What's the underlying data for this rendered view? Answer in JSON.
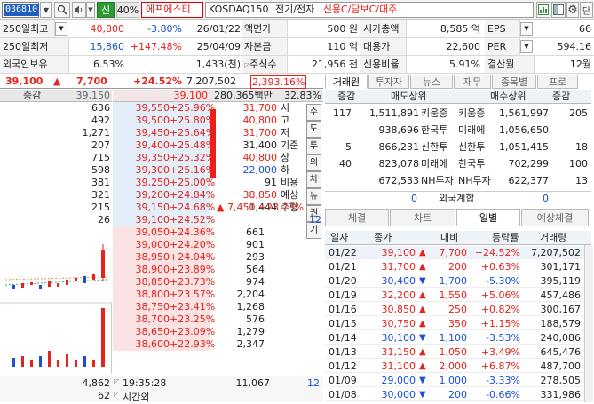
{
  "toolbar": {
    "code": "036810",
    "lang": "신",
    "zoom": "40%",
    "stock_name": "에프에스티",
    "index": "KOSDAQ150",
    "sector": "전기/전자",
    "tags": "신용C/담보C/대주",
    "letter": "단"
  },
  "summary": {
    "row1": {
      "label": "250일최고",
      "value": "40,800",
      "rate": "-3.80%",
      "date": "26/01/22",
      "l2": "액면가",
      "v2": "500 원",
      "l3": "시가총액",
      "v3": "8,585 억",
      "l4": "EPS",
      "v4": "66"
    },
    "row2": {
      "label": "250일최저",
      "value": "15,860",
      "rate": "+147.48%",
      "date": "25/04/09",
      "l2": "자본금",
      "v2": "110 억",
      "l3": "대용가",
      "v3": "22,600",
      "l4": "PER",
      "v4": "594.16"
    },
    "row3": {
      "label": "외국인보유",
      "value": "6.53%",
      "rate": "1,433(천)",
      "l2": "주식수",
      "v2": "21,956 천",
      "l3": "신용비율",
      "v3": "5.91%",
      "l4": "결산월",
      "v4": "12월"
    }
  },
  "price": {
    "current": "39,100",
    "arrow": "▲",
    "change": "7,700",
    "rate": "+24.52%",
    "volume": "7,207,502",
    "ratio": "2,393.16%"
  },
  "ob_header": {
    "label": "증감",
    "p1": "39,150",
    "p2": "39,100",
    "amount": "280,365백만",
    "rate": "32.83%"
  },
  "asks": [
    {
      "q": "636",
      "p": "39,550",
      "r": "+25.96%"
    },
    {
      "q": "492",
      "p": "39,500",
      "r": "+25.80%"
    },
    {
      "q": "1,271",
      "p": "39,450",
      "r": "+25.64%"
    },
    {
      "q": "207",
      "p": "39,400",
      "r": "+25.48%"
    },
    {
      "q": "715",
      "p": "39,350",
      "r": "+25.32%"
    },
    {
      "q": "598",
      "p": "39,300",
      "r": "+25.16%"
    },
    {
      "q": "381",
      "p": "39,250",
      "r": "+25.00%"
    },
    {
      "q": "321",
      "p": "39,200",
      "r": "+24.84%"
    },
    {
      "q": "215",
      "p": "39,150",
      "r": "+24.68%"
    },
    {
      "q": "26",
      "p": "39,100",
      "r": "+24.52%"
    }
  ],
  "side_info": [
    {
      "v": "31,700",
      "l": "시"
    },
    {
      "v": "40,800",
      "l": "고"
    },
    {
      "v": "31,700",
      "l": "저"
    },
    {
      "v": "31,400",
      "l": "기준"
    },
    {
      "v": "40,800",
      "l": "상"
    },
    {
      "v": "22,000",
      "l": "하"
    },
    {
      "v": "91",
      "l": "비용"
    },
    {
      "v": "38,850",
      "l": "예상"
    },
    {
      "v": "1,444",
      "l": "수량"
    }
  ],
  "expected": {
    "arrow": "▲",
    "change": "7,450",
    "rate": "+23.73%"
  },
  "side_tabs": [
    "수",
    "도",
    "투",
    "외",
    "차",
    "뉴",
    "권",
    "기"
  ],
  "bids": [
    {
      "p": "39,050",
      "r": "+24.36%",
      "q": "661"
    },
    {
      "p": "39,000",
      "r": "+24.20%",
      "q": "901"
    },
    {
      "p": "38,950",
      "r": "+24.04%",
      "q": "293"
    },
    {
      "p": "38,900",
      "r": "+23.89%",
      "q": "564"
    },
    {
      "p": "38,850",
      "r": "+23.73%",
      "q": "974"
    },
    {
      "p": "38,800",
      "r": "+23.57%",
      "q": "2,204"
    },
    {
      "p": "38,750",
      "r": "+23.41%",
      "q": "1,268"
    },
    {
      "p": "38,700",
      "r": "+23.25%",
      "q": "576"
    },
    {
      "p": "38,650",
      "r": "+23.09%",
      "q": "1,279"
    },
    {
      "p": "38,600",
      "r": "+22.93%",
      "q": "2,347"
    }
  ],
  "bid_side_val": "12",
  "ob_footer": {
    "total_ask": "4,862",
    "time": "19:35:28",
    "total_bid": "11,067",
    "right": "12",
    "count": "62",
    "time_label": "시간외"
  },
  "right_tabs": [
    "거래원",
    "투자자",
    "뉴스",
    "재무",
    "종목별",
    "프로"
  ],
  "broker": {
    "h_change1": "증감",
    "h_sell": "매도상위",
    "h_buy": "매수상위",
    "h_change2": "증감",
    "rows": [
      {
        "c1": "117",
        "sv": "1,511,891",
        "sn": "키움증",
        "bn": "키움증",
        "bv": "1,561,997",
        "c2": "205"
      },
      {
        "c1": "",
        "sv": "938,696",
        "sn": "한국투",
        "bn": "미래에",
        "bv": "1,056,650",
        "c2": ""
      },
      {
        "c1": "5",
        "sv": "866,231",
        "sn": "신한투",
        "bn": "신한투",
        "bv": "1,051,415",
        "c2": "18"
      },
      {
        "c1": "40",
        "sv": "823,078",
        "sn": "미래에",
        "bn": "한국투",
        "bv": "702,299",
        "c2": "100"
      },
      {
        "c1": "",
        "sv": "672,533",
        "sn": "NH투자",
        "bn": "NH투자",
        "bv": "622,377",
        "c2": "13"
      }
    ],
    "foreign": {
      "left": "0",
      "label": "외국계합",
      "right": "0"
    }
  },
  "sub_tabs": [
    "체결",
    "차트",
    "일별",
    "예상체결"
  ],
  "daily": {
    "headers": [
      "일자",
      "종가",
      "대비",
      "등락률",
      "거래량"
    ],
    "rows": [
      {
        "d": "01/22",
        "c": "39,100",
        "a": "▲",
        "v": "7,700",
        "r": "+24.52%",
        "vol": "7,207,502",
        "dir": "up"
      },
      {
        "d": "01/21",
        "c": "31,700",
        "a": "▲",
        "v": "200",
        "r": "+0.63%",
        "vol": "301,171",
        "dir": "up"
      },
      {
        "d": "01/20",
        "c": "30,400",
        "a": "▼",
        "v": "1,700",
        "r": "-5.30%",
        "vol": "395,119",
        "dir": "down"
      },
      {
        "d": "01/19",
        "c": "32,200",
        "a": "▲",
        "v": "1,550",
        "r": "+5.06%",
        "vol": "457,486",
        "dir": "up"
      },
      {
        "d": "01/16",
        "c": "30,850",
        "a": "▲",
        "v": "250",
        "r": "+0.82%",
        "vol": "300,167",
        "dir": "up"
      },
      {
        "d": "01/15",
        "c": "30,750",
        "a": "▲",
        "v": "350",
        "r": "+1.15%",
        "vol": "188,579",
        "dir": "up"
      },
      {
        "d": "01/14",
        "c": "30,100",
        "a": "▼",
        "v": "1,100",
        "r": "-3.53%",
        "vol": "240,086",
        "dir": "down"
      },
      {
        "d": "01/13",
        "c": "31,150",
        "a": "▲",
        "v": "1,050",
        "r": "+3.49%",
        "vol": "645,476",
        "dir": "up"
      },
      {
        "d": "01/12",
        "c": "31,100",
        "a": "▲",
        "v": "2,000",
        "r": "+6.87%",
        "vol": "487,700",
        "dir": "up"
      },
      {
        "d": "01/09",
        "c": "29,000",
        "a": "▼",
        "v": "1,000",
        "r": "-3.33%",
        "vol": "278,505",
        "dir": "down"
      },
      {
        "d": "01/08",
        "c": "30,000",
        "a": "▼",
        "v": "200",
        "r": "-0.66%",
        "vol": "331,986",
        "dir": "down"
      }
    ]
  },
  "colors": {
    "up": "#e8211a",
    "down": "#1a4fd6",
    "ask_bg": "#e3eef8",
    "bid_bg": "#fbe3e3"
  },
  "icons": [
    "search-icon",
    "speaker-icon",
    "chart-icon",
    "layout-icon",
    "gear-icon"
  ]
}
